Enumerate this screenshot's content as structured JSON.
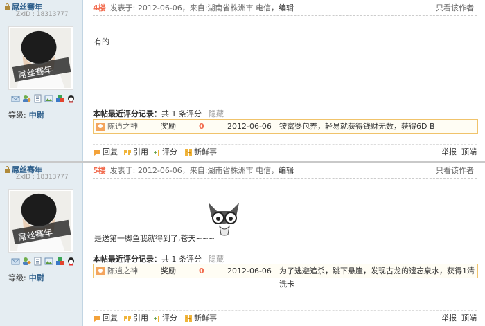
{
  "posts": [
    {
      "user": {
        "name": "屌丝骞年",
        "zxid": "ZxID : 18313777",
        "level_label": "等级:",
        "level_value": "中尉",
        "avatar_text": "屌丝骞年"
      },
      "floor": "4楼",
      "meta": "发表于: 2012-06-06，来自:湖南省株洲市 电信，",
      "edit": "编辑",
      "only_author": "只看该作者",
      "content": "有的",
      "rate_header": "本帖最近评分记录：",
      "rate_count": "共 1 条评分",
      "rate_hide": "隐藏",
      "rate": {
        "user": "陈逍之神",
        "type": "奖励",
        "score": "0",
        "date": "2012-06-06",
        "reason": "铵富婆包养，轻易就获得钱财无数，获得6D B"
      },
      "actions": {
        "reply": "回复",
        "quote": "引用",
        "rate": "评分",
        "news": "新鲜事",
        "report": "举报",
        "top": "顶端"
      }
    },
    {
      "user": {
        "name": "屌丝骞年",
        "zxid": "ZxID : 18313777",
        "level_label": "等级:",
        "level_value": "中尉",
        "avatar_text": "屌丝骞年"
      },
      "floor": "5楼",
      "meta": "发表于: 2012-06-06，来自:湖南省株洲市 电信，",
      "edit": "编辑",
      "only_author": "只看该作者",
      "content": "是送第一脚鱼我就得到了,苍天~~~",
      "rate_header": "本帖最近评分记录：",
      "rate_count": "共 1 条评分",
      "rate_hide": "隐藏",
      "rate": {
        "user": "陈逍之神",
        "type": "奖励",
        "score": "0",
        "date": "2012-06-06",
        "reason": "为了逃避追杀，跳下悬崖，发现古龙的遗忘泉水，获得1清洗卡"
      },
      "actions": {
        "reply": "回复",
        "quote": "引用",
        "rate": "评分",
        "news": "新鲜事",
        "report": "举报",
        "top": "顶端"
      }
    }
  ],
  "colors": {
    "floor": "#f26c4f",
    "username": "#2b5d8a",
    "sidebar": "#e5edf2",
    "rate_border": "#f0c36b",
    "score": "#f26c4f"
  },
  "icons": [
    "message-icon",
    "add-friend-icon",
    "profile-icon",
    "album-icon",
    "share-icon",
    "qq-icon",
    "reply-icon",
    "quote-icon",
    "rate-icon",
    "news-icon",
    "lock-icon",
    "rater-icon"
  ]
}
